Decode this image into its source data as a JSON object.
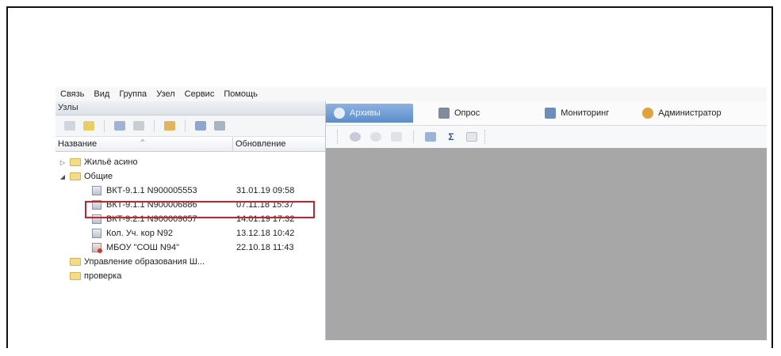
{
  "menu": [
    "Связь",
    "Вид",
    "Группа",
    "Узел",
    "Сервис",
    "Помощь"
  ],
  "left_panel": {
    "title": "Узлы",
    "columns": {
      "name": "Название",
      "updated": "Обновление"
    },
    "tree": [
      {
        "type": "folder",
        "level": 0,
        "expander": "▷",
        "name": "Жильё асино",
        "updated": ""
      },
      {
        "type": "folder",
        "level": 0,
        "expander": "◢",
        "name": "Общие",
        "updated": ""
      },
      {
        "type": "device",
        "level": 1,
        "name": "ВКТ-9.1.1 N900005553",
        "updated": "31.01.19 09:58",
        "highlighted": true
      },
      {
        "type": "device",
        "level": 1,
        "name": "ВКТ-9.1.1 N900006886",
        "updated": "07.11.18 15:37"
      },
      {
        "type": "device",
        "level": 1,
        "name": "ВКТ-9.2.1 N900009657",
        "updated": "14.01.19 17:32"
      },
      {
        "type": "device",
        "level": 1,
        "name": "Кол. Уч. кор N92",
        "updated": "13.12.18 10:42"
      },
      {
        "type": "device-alert",
        "level": 1,
        "name": "МБОУ \"СОШ N94\"",
        "updated": "22.10.18 11:43"
      },
      {
        "type": "folder",
        "level": 0,
        "expander": "",
        "name": "Управление образования Ш...",
        "updated": ""
      },
      {
        "type": "folder",
        "level": 0,
        "expander": "",
        "name": "проверка",
        "updated": ""
      }
    ]
  },
  "tabs": [
    {
      "label": "Архивы",
      "icon": "archive-icon",
      "active": true
    },
    {
      "label": "Опрос",
      "icon": "poll-icon",
      "active": false
    },
    {
      "label": "Мониторинг",
      "icon": "monitor-icon",
      "active": false
    },
    {
      "label": "Администратор",
      "icon": "admin-icon",
      "active": false
    }
  ],
  "right_toolbar": {
    "sum_symbol": "Σ"
  },
  "colors": {
    "highlight": "#c8232c",
    "active_tab": "#6e9bd6",
    "content_bg": "#a7a7a7",
    "folder": "#f3dc8a"
  }
}
